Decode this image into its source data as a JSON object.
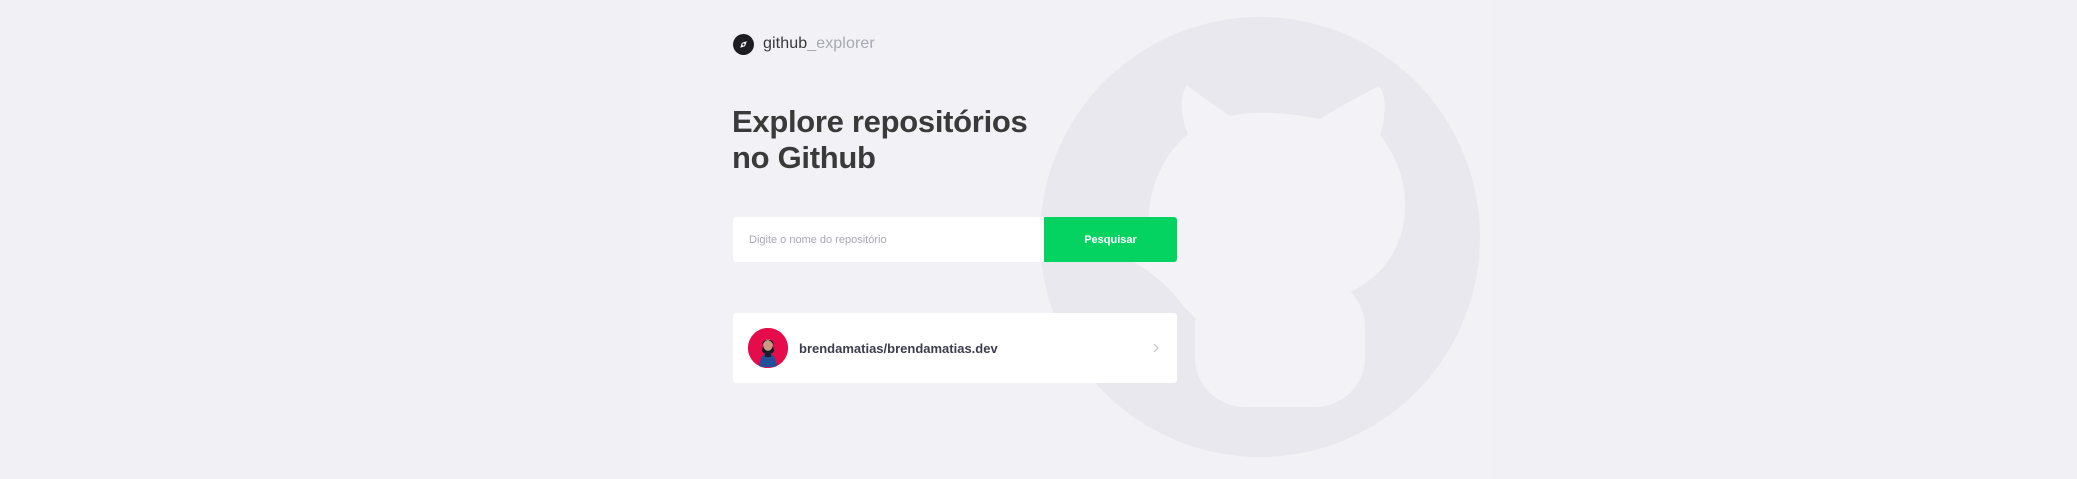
{
  "header": {
    "brand_prefix": "github",
    "brand_suffix": "_explorer",
    "logo_icon": "compass-icon"
  },
  "main": {
    "title_line_1": "Explore repositórios",
    "title_line_2": "no Github"
  },
  "search": {
    "placeholder": "Digite o nome do repositório",
    "value": "",
    "button_label": "Pesquisar"
  },
  "repositories": [
    {
      "full_name": "brendamatias/brendamatias.dev",
      "avatar": "avatar",
      "action_icon": "chevron-right-icon"
    }
  ],
  "colors": {
    "background": "#f0f0f5",
    "text": "#3a3a3a",
    "muted": "#a8a8b3",
    "accent": "#04d361",
    "card": "#ffffff"
  }
}
